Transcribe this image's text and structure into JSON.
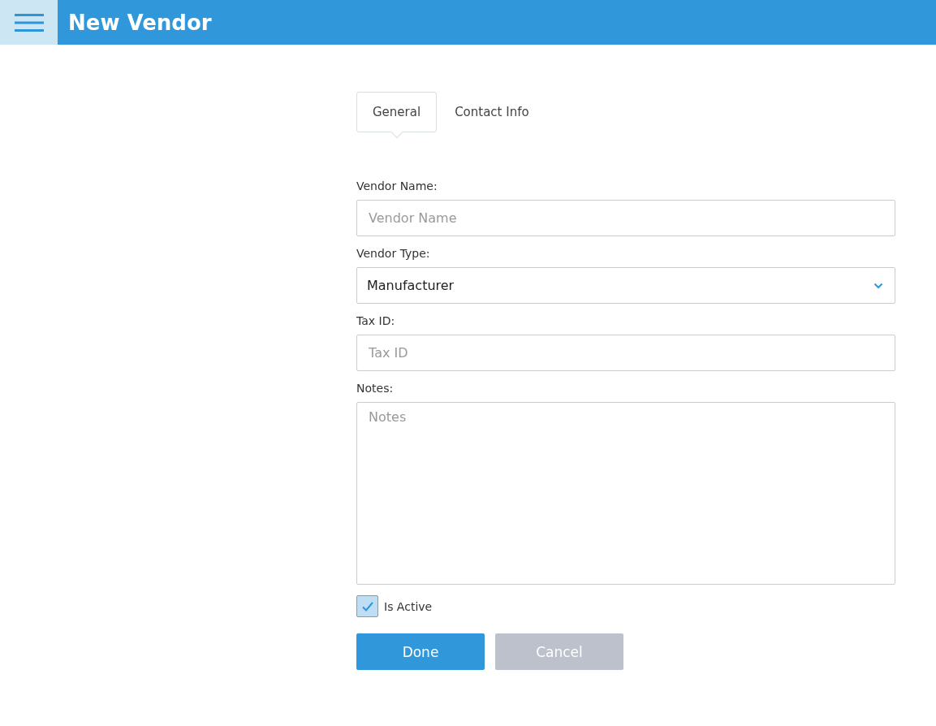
{
  "header": {
    "title": "New Vendor"
  },
  "tabs": [
    {
      "label": "General",
      "selected": true
    },
    {
      "label": "Contact Info",
      "selected": false
    }
  ],
  "fields": [
    {
      "kind": "text",
      "label": "Vendor Name:",
      "placeholder": "Vendor Name"
    },
    {
      "kind": "select",
      "label": "Vendor Type:",
      "value": "Manufacturer"
    },
    {
      "kind": "text",
      "label": "Tax ID:",
      "placeholder": "Tax ID"
    },
    {
      "kind": "textarea",
      "label": "Notes:",
      "placeholder": "Notes"
    }
  ],
  "checkbox": {
    "label": "Is Active",
    "checked": true
  },
  "buttons": [
    {
      "label": "Done",
      "kind": "primary"
    },
    {
      "label": "Cancel",
      "kind": "secondary"
    }
  ]
}
